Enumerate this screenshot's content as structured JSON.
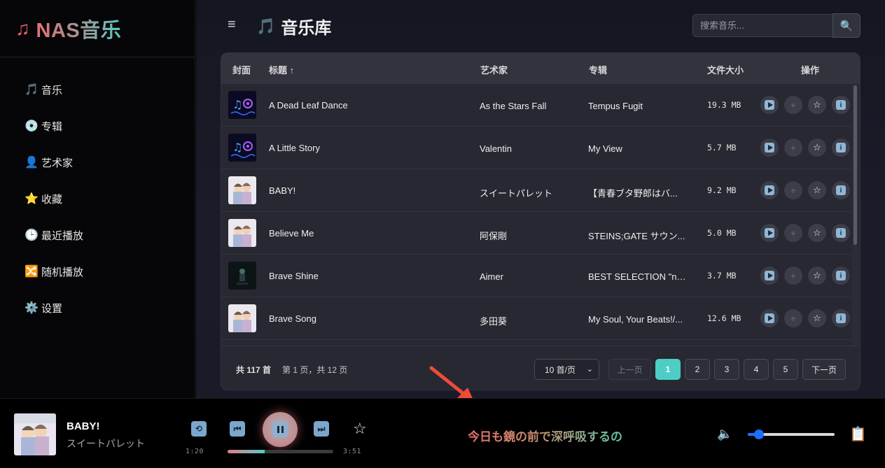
{
  "app": {
    "logo_icon": "music-note-icon",
    "logo_text": "NAS音乐"
  },
  "sidebar": {
    "items": [
      {
        "icon": "🎵",
        "label": "音乐"
      },
      {
        "icon": "💿",
        "label": "专辑"
      },
      {
        "icon": "👤",
        "label": "艺术家"
      },
      {
        "icon": "⭐",
        "label": "收藏"
      },
      {
        "icon": "🕒",
        "label": "最近播放"
      },
      {
        "icon": "🔀",
        "label": "随机播放"
      },
      {
        "icon": "⚙️",
        "label": "设置"
      }
    ]
  },
  "header": {
    "menu_icon": "≡",
    "title_icon": "🎵",
    "title": "音乐库",
    "search_placeholder": "搜索音乐...",
    "search_icon": "🔍"
  },
  "table": {
    "columns": {
      "cover": "封面",
      "title": "标题 ↑",
      "artist": "艺术家",
      "album": "专辑",
      "size": "文件大小",
      "actions": "操作"
    },
    "rows": [
      {
        "title": "A Dead Leaf Dance",
        "artist": "As the Stars Fall",
        "album": "Tempus Fugit",
        "size": "19.3 MB",
        "cover": "placeholder-music-icon"
      },
      {
        "title": "A Little Story",
        "artist": "Valentin",
        "album": "My View",
        "size": "5.7 MB",
        "cover": "placeholder-music-icon"
      },
      {
        "title": "BABY!",
        "artist": "スイートパレット",
        "album": "【青春ブタ野郎はバ...",
        "size": "9.2 MB",
        "cover": "anime-art"
      },
      {
        "title": "Believe Me",
        "artist": "阿保剛",
        "album": "STEINS;GATE サウン...",
        "size": "5.0 MB",
        "cover": "anime-art"
      },
      {
        "title": "Brave Shine",
        "artist": "Aimer",
        "album": "BEST SELECTION \"noir\"",
        "size": "3.7 MB",
        "cover": "dark-art"
      },
      {
        "title": "Brave Song",
        "artist": "多田葵",
        "album": "My Soul, Your Beats!/...",
        "size": "12.6 MB",
        "cover": "anime-art"
      }
    ],
    "action_icons": [
      "play-icon",
      "add-icon",
      "star-icon",
      "info-icon"
    ],
    "action_glyphs": {
      "add": "+",
      "star": "☆",
      "info": "i"
    }
  },
  "pagination": {
    "total": "共 117 首",
    "page_info": "第 1 页，共 12 页",
    "per_page": "10 首/页",
    "prev": "上一页",
    "pages": [
      "1",
      "2",
      "3",
      "4",
      "5"
    ],
    "current": "1",
    "next": "下一页"
  },
  "player": {
    "title": "BABY!",
    "artist": "スイートパレット",
    "current_time": "1:20",
    "total_time": "3:51",
    "progress": 0.35,
    "lyric": "今日も鏡の前で深呼吸するの",
    "volume": 0.13,
    "star_glyph": "☆",
    "volume_icon": "🔈",
    "queue_icon": "📋"
  },
  "colors": {
    "accent": "#4ecdc4",
    "brand_red": "#e45a6a",
    "annotation": "#f04a3a"
  }
}
